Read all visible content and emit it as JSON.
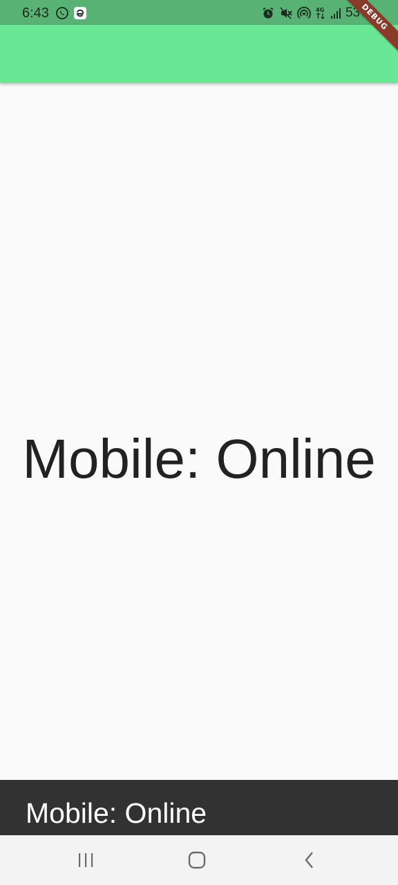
{
  "status_bar": {
    "time": "6:43",
    "battery": "53%",
    "background_color": "#58b274",
    "left_icons": [
      "whatsapp-icon",
      "e-app-icon"
    ],
    "right_icons": [
      "alarm-icon",
      "mute-icon",
      "hotspot-icon",
      "4g-data-icon",
      "signal-icon"
    ]
  },
  "app_bar": {
    "background_color": "#69e795"
  },
  "debug_banner": {
    "label": "DEBUG"
  },
  "main": {
    "status_text": "Mobile: Online"
  },
  "snackbar": {
    "message": "Mobile: Online"
  },
  "nav_bar": {
    "buttons": [
      "recent-apps-icon",
      "home-icon",
      "back-icon"
    ]
  }
}
